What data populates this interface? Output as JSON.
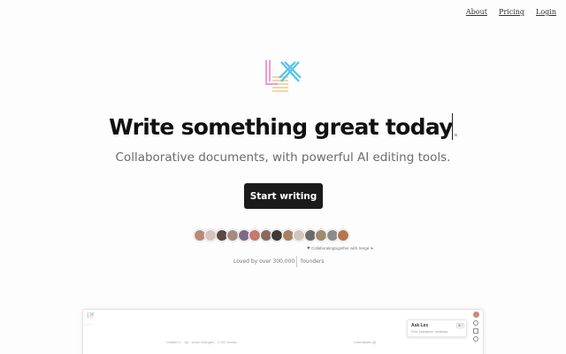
{
  "nav": {
    "about": "About",
    "pricing": "Pricing",
    "login": "Login"
  },
  "hero": {
    "title": "Write something great today",
    "subtitle": "Collaborative documents, with powerful AI editing tools.",
    "cta": "Start writing"
  },
  "social": {
    "collab_tag": "Collaboratingtogether with Serge",
    "loved": "Loved by over 300,000",
    "founders": "founders"
  },
  "preview": {
    "meta": "Untitled 1 · 4β · show changes · 2,157 words",
    "comments": "Comments (4)",
    "ask_title": "Ask Lex",
    "ask_sub": "Find, brainstorm, feedback",
    "ask_key": "⌘J"
  },
  "colors": {
    "cta_bg": "#1b1b1b",
    "logo_pink": "#f29ac8",
    "logo_blue": "#54c3e8",
    "logo_tan": "#f2d6a8",
    "accent_purple": "#7b4bd6"
  },
  "avatar_colors": [
    "#b98a74",
    "#d9c4bd",
    "#5a4a42",
    "#a48d80",
    "#7d6b8b",
    "#c47a6e",
    "#8a6a5a",
    "#3f3a36",
    "#a98062",
    "#cfc6bd",
    "#6f6a65",
    "#9f8a6e",
    "#8c8c8c",
    "#b5764f"
  ]
}
